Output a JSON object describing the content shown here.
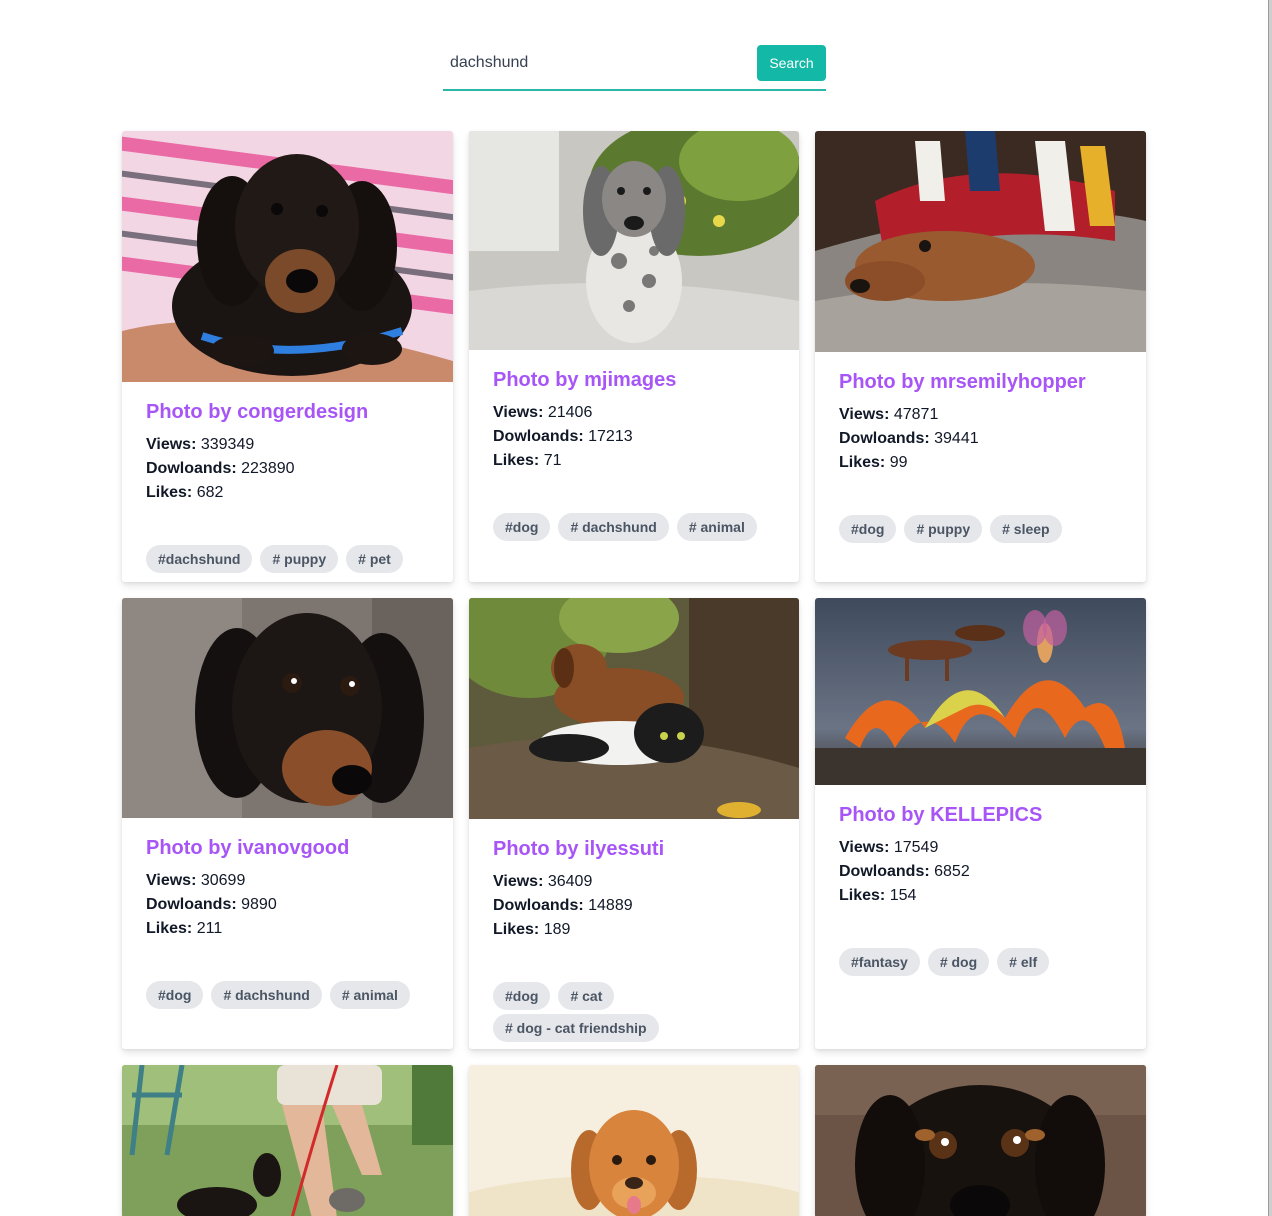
{
  "search": {
    "value": "dachshund",
    "button_label": "Search"
  },
  "colors": {
    "accent": "#14b8a6",
    "title": "#a855f7",
    "tag_bg": "#e5e7eb"
  },
  "labels": {
    "views": "Views:",
    "downloads": "Dowloands:",
    "likes": "Likes:"
  },
  "cards": [
    {
      "title": "Photo by congerdesign",
      "views": "339349",
      "downloads": "223890",
      "likes": "682",
      "tags": [
        "#dachshund",
        "# puppy",
        "# pet"
      ]
    },
    {
      "title": "Photo by mjimages",
      "views": "21406",
      "downloads": "17213",
      "likes": "71",
      "tags": [
        "#dog",
        "# dachshund",
        "# animal"
      ]
    },
    {
      "title": "Photo by mrsemilyhopper",
      "views": "47871",
      "downloads": "39441",
      "likes": "99",
      "tags": [
        "#dog",
        "# puppy",
        "# sleep"
      ]
    },
    {
      "title": "Photo by ivanovgood",
      "views": "30699",
      "downloads": "9890",
      "likes": "211",
      "tags": [
        "#dog",
        "# dachshund",
        "# animal"
      ]
    },
    {
      "title": "Photo by ilyessuti",
      "views": "36409",
      "downloads": "14889",
      "likes": "189",
      "tags": [
        "#dog",
        "# cat",
        "# dog - cat friendship"
      ]
    },
    {
      "title": "Photo by KELLEPICS",
      "views": "17549",
      "downloads": "6852",
      "likes": "154",
      "tags": [
        "#fantasy",
        "# dog",
        "# elf"
      ]
    }
  ]
}
